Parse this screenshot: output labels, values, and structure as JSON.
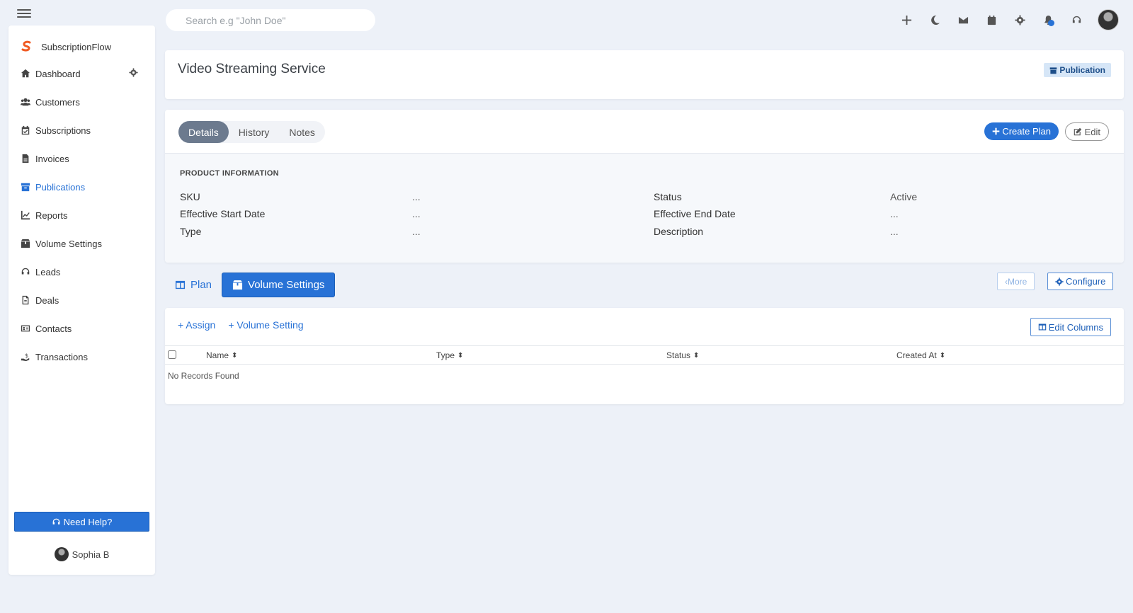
{
  "search": {
    "placeholder": "Search e.g \"John Doe\""
  },
  "topbar_icons": [
    "plus-icon",
    "moon-icon",
    "envelope-icon",
    "calendar-icon",
    "gear-icon",
    "bell-icon",
    "headset-icon"
  ],
  "sidebar": {
    "brand": "SubscriptionFlow",
    "items": [
      {
        "label": "Dashboard",
        "icon": "home-icon"
      },
      {
        "label": "Customers",
        "icon": "users-icon"
      },
      {
        "label": "Subscriptions",
        "icon": "calendar-check-icon"
      },
      {
        "label": "Invoices",
        "icon": "invoice-icon"
      },
      {
        "label": "Publications",
        "icon": "archive-icon",
        "active": true
      },
      {
        "label": "Reports",
        "icon": "chart-line-icon"
      },
      {
        "label": "Volume Settings",
        "icon": "box-icon"
      },
      {
        "label": "Leads",
        "icon": "headset-icon"
      },
      {
        "label": "Deals",
        "icon": "file-icon"
      },
      {
        "label": "Contacts",
        "icon": "address-card-icon"
      },
      {
        "label": "Transactions",
        "icon": "hand-dollar-icon"
      }
    ],
    "help_label": "Need Help?",
    "user_name": "Sophia B"
  },
  "header": {
    "title": "Video Streaming Service",
    "badge": "Publication"
  },
  "details": {
    "tabs": [
      "Details",
      "History",
      "Notes"
    ],
    "active_tab": "Details",
    "create_plan_label": "Create Plan",
    "edit_label": "Edit",
    "section_title": "PRODUCT INFORMATION",
    "fields": {
      "sku_label": "SKU",
      "sku_value": "...",
      "start_label": "Effective Start Date",
      "start_value": "...",
      "type_label": "Type",
      "type_value": "...",
      "status_label": "Status",
      "status_value": "Active",
      "end_label": "Effective End Date",
      "end_value": "...",
      "desc_label": "Description",
      "desc_value": "..."
    }
  },
  "subtabs": {
    "plan_label": "Plan",
    "volume_label": "Volume Settings",
    "more_label": "More",
    "configure_label": "Configure"
  },
  "table": {
    "assign_label": "+ Assign",
    "volume_setting_label": "+ Volume Setting",
    "edit_columns_label": "Edit Columns",
    "columns": [
      "Name",
      "Type",
      "Status",
      "Created At"
    ],
    "empty_text": "No Records Found"
  },
  "colors": {
    "accent": "#2872d6",
    "background": "#edf1f8",
    "pill_active": "#6c7a8e"
  }
}
